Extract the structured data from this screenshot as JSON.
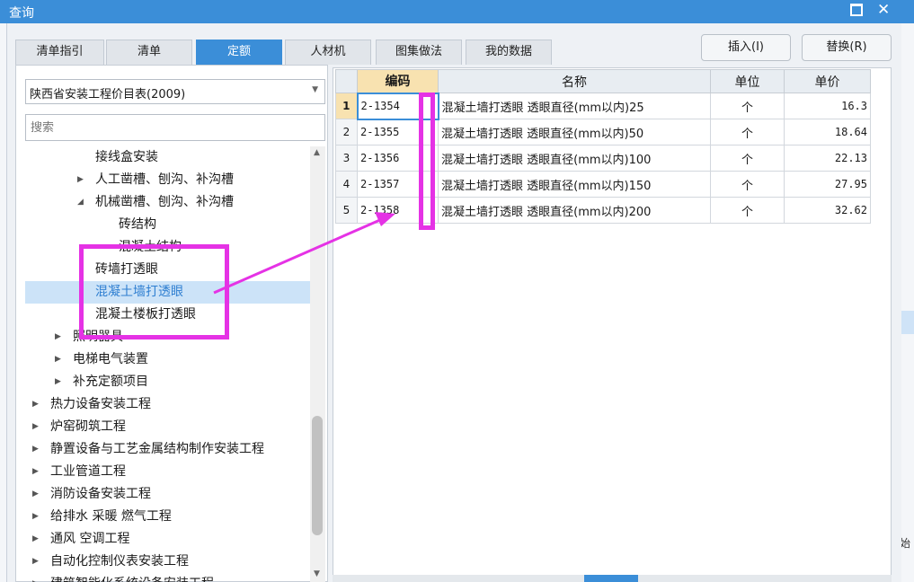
{
  "window": {
    "title": "查询"
  },
  "tabs": [
    {
      "label": "清单指引"
    },
    {
      "label": "清单"
    },
    {
      "label": "定额"
    },
    {
      "label": "人材机"
    },
    {
      "label": "图集做法"
    },
    {
      "label": "我的数据"
    }
  ],
  "active_tab": "定额",
  "actions": {
    "insert_label": "插入(I)",
    "replace_label": "替换(R)"
  },
  "library": {
    "selected": "陕西省安装工程价目表(2009)"
  },
  "search": {
    "placeholder": "搜索",
    "value": ""
  },
  "tree": [
    {
      "label": "接线盒安装",
      "toggle": ""
    },
    {
      "label": "人工凿槽、刨沟、补沟槽",
      "toggle": "▶"
    },
    {
      "label": "机械凿槽、刨沟、补沟槽",
      "toggle": "◢"
    },
    {
      "label": "砖结构",
      "toggle": ""
    },
    {
      "label": "混凝土结构",
      "toggle": ""
    },
    {
      "label": "砖墙打透眼",
      "toggle": ""
    },
    {
      "label": "混凝土墙打透眼",
      "toggle": "",
      "selected": true
    },
    {
      "label": "混凝土楼板打透眼",
      "toggle": ""
    },
    {
      "label": "照明器具",
      "toggle": "▶"
    },
    {
      "label": "电梯电气装置",
      "toggle": "▶"
    },
    {
      "label": "补充定额项目",
      "toggle": "▶"
    },
    {
      "label": "热力设备安装工程",
      "toggle": "▶"
    },
    {
      "label": "炉窑砌筑工程",
      "toggle": "▶"
    },
    {
      "label": "静置设备与工艺金属结构制作安装工程",
      "toggle": "▶"
    },
    {
      "label": "工业管道工程",
      "toggle": "▶"
    },
    {
      "label": "消防设备安装工程",
      "toggle": "▶"
    },
    {
      "label": "给排水 采暖 燃气工程",
      "toggle": "▶"
    },
    {
      "label": "通风 空调工程",
      "toggle": "▶"
    },
    {
      "label": "自动化控制仪表安装工程",
      "toggle": "▶"
    },
    {
      "label": "建筑智能化系统设备安装工程",
      "toggle": "▶"
    }
  ],
  "grid": {
    "headers": {
      "code": "编码",
      "name": "名称",
      "unit": "单位",
      "price": "单价"
    },
    "rows": [
      {
        "n": "1",
        "code": "2-1354",
        "name": "混凝土墙打透眼 透眼直径(mm以内)25",
        "unit": "个",
        "price": "16.3"
      },
      {
        "n": "2",
        "code": "2-1355",
        "name": "混凝土墙打透眼 透眼直径(mm以内)50",
        "unit": "个",
        "price": "18.64"
      },
      {
        "n": "3",
        "code": "2-1356",
        "name": "混凝土墙打透眼 透眼直径(mm以内)100",
        "unit": "个",
        "price": "22.13"
      },
      {
        "n": "4",
        "code": "2-1357",
        "name": "混凝土墙打透眼 透眼直径(mm以内)150",
        "unit": "个",
        "price": "27.95"
      },
      {
        "n": "5",
        "code": "2-1358",
        "name": "混凝土墙打透眼 透眼直径(mm以内)200",
        "unit": "个",
        "price": "32.62"
      }
    ]
  },
  "background": {
    "right_edge_text": "始"
  },
  "colors": {
    "accent": "#3b8ed8",
    "annotation": "#e532e5",
    "selected_row": "#cce3f8",
    "header_highlight": "#f8e2b0"
  }
}
